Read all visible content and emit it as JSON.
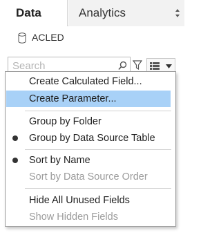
{
  "tabs": [
    {
      "label": "Data",
      "active": true
    },
    {
      "label": "Analytics",
      "active": false
    }
  ],
  "datasource": {
    "name": "ACLED",
    "icon": "database-icon"
  },
  "search": {
    "placeholder": "Search",
    "value": ""
  },
  "toolbar": {
    "filter_icon": "filter-icon",
    "view_icon": "list-view-icon",
    "dropdown_icon": "chevron-down-icon"
  },
  "menu": {
    "items": [
      {
        "label": "Create Calculated Field...",
        "enabled": true,
        "checked": false,
        "highlighted": false
      },
      {
        "label": "Create Parameter...",
        "enabled": true,
        "checked": false,
        "highlighted": true
      },
      {
        "label": "Group by Folder",
        "enabled": true,
        "checked": false,
        "highlighted": false
      },
      {
        "label": "Group by Data Source Table",
        "enabled": true,
        "checked": true,
        "highlighted": false
      },
      {
        "label": "Sort by Name",
        "enabled": true,
        "checked": true,
        "highlighted": false
      },
      {
        "label": "Sort by Data Source Order",
        "enabled": false,
        "checked": false,
        "highlighted": false
      },
      {
        "label": "Hide All Unused Fields",
        "enabled": true,
        "checked": false,
        "highlighted": false
      },
      {
        "label": "Show Hidden Fields",
        "enabled": false,
        "checked": false,
        "highlighted": false
      }
    ]
  },
  "colors": {
    "highlight": "#a8d1f7",
    "disabled_text": "#9b9b9b",
    "tab_inactive_bg": "#f2f2f2"
  }
}
